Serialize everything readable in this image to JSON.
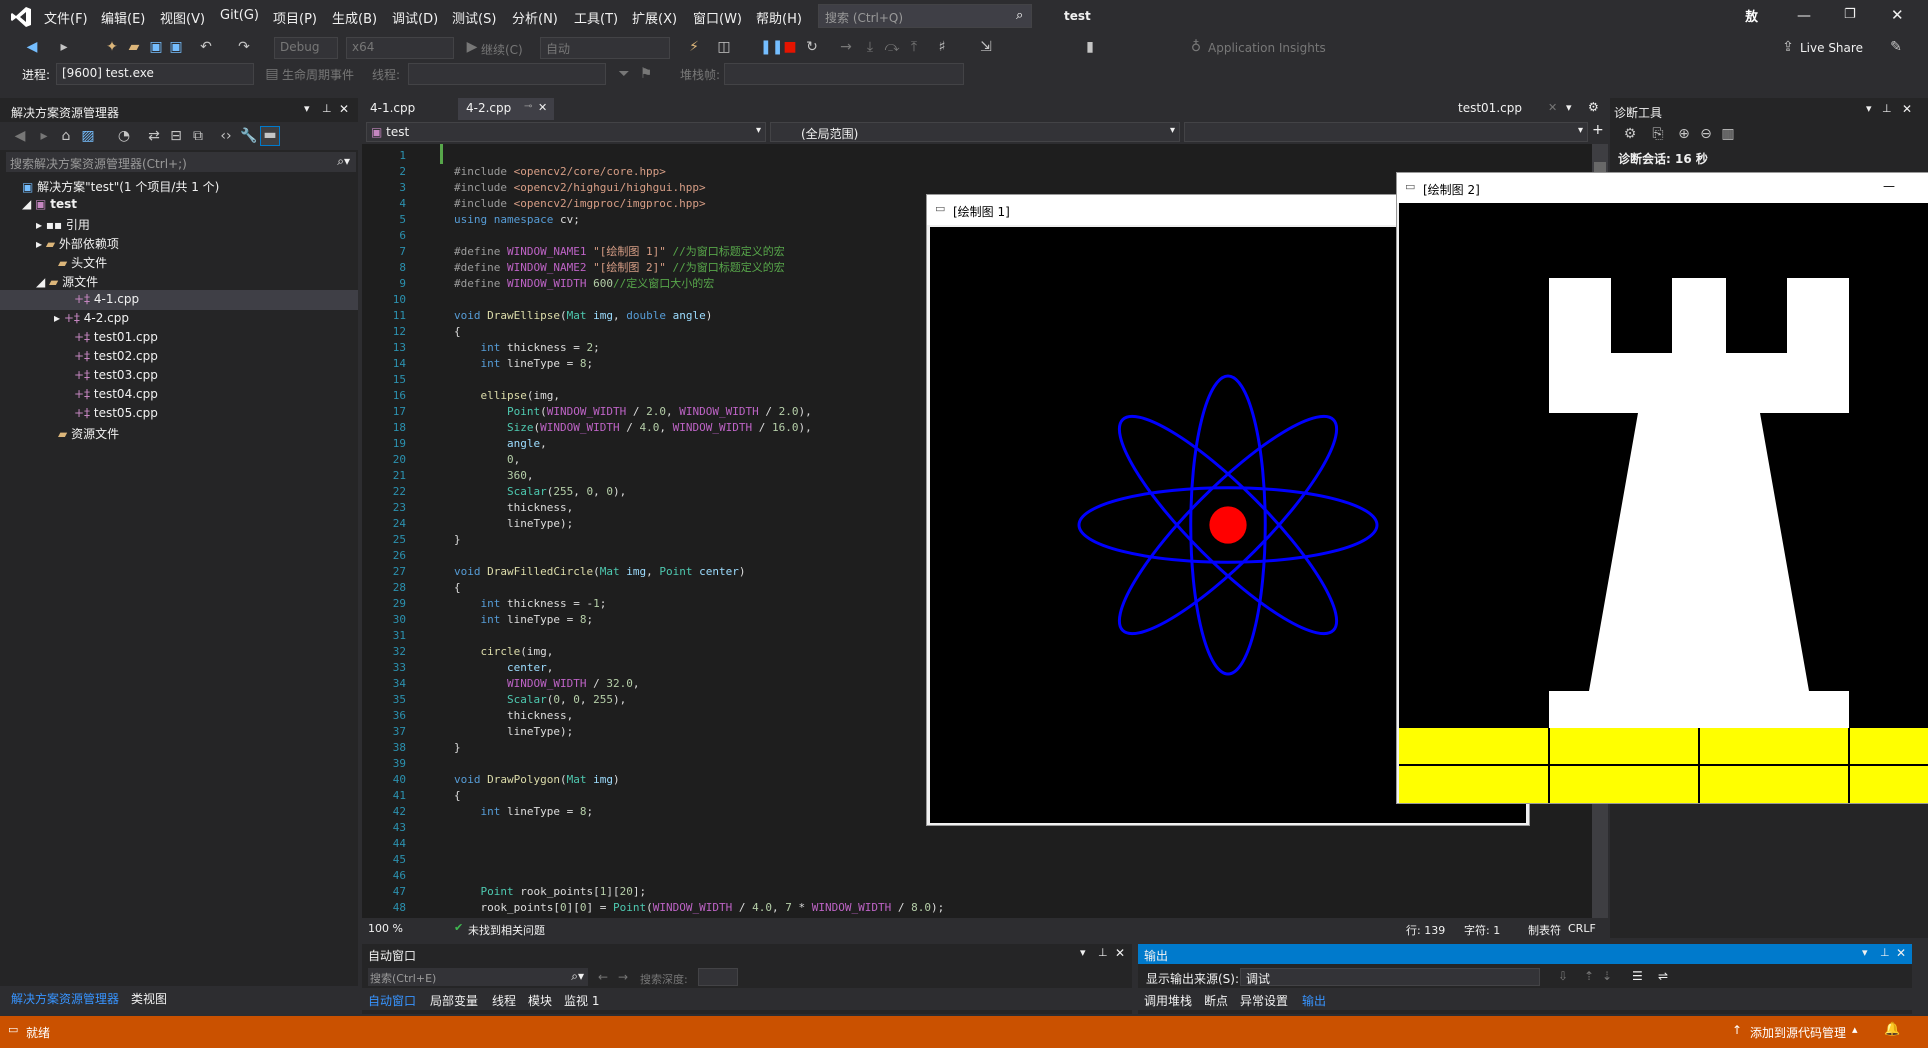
{
  "menubar": {
    "items": [
      "文件(F)",
      "编辑(E)",
      "视图(V)",
      "Git(G)",
      "项目(P)",
      "生成(B)",
      "调试(D)",
      "测试(S)",
      "分析(N)",
      "工具(T)",
      "扩展(X)",
      "窗口(W)",
      "帮助(H)"
    ],
    "search_placeholder": "搜索 (Ctrl+Q)",
    "solution_name": "test",
    "user_badge": "敖"
  },
  "toolbar": {
    "config": "Debug",
    "platform": "x64",
    "continue_label": "继续(C)",
    "auto_label": "自动",
    "app_insights": "Application Insights",
    "live_share": "Live Share"
  },
  "toolbar2": {
    "process_label": "进程:",
    "process_value": "[9600] test.exe",
    "lifecycle_label": "生命周期事件",
    "thread_label": "线程:",
    "stack_label": "堆栈帧:"
  },
  "solution_explorer": {
    "title": "解决方案资源管理器",
    "search_placeholder": "搜索解决方案资源管理器(Ctrl+;)",
    "solution": "解决方案\"test\"(1 个项目/共 1 个)",
    "project": "test",
    "nodes": [
      "引用",
      "外部依赖项",
      "头文件",
      "源文件",
      "4-1.cpp",
      "4-2.cpp",
      "test01.cpp",
      "test02.cpp",
      "test03.cpp",
      "test04.cpp",
      "test05.cpp",
      "资源文件"
    ],
    "bottom_tabs": [
      "解决方案资源管理器",
      "类视图"
    ]
  },
  "editor": {
    "tabs": [
      "4-1.cpp",
      "4-2.cpp"
    ],
    "right_tab": "test01.cpp",
    "nav_project": "test",
    "nav_scope": "(全局范围)",
    "zoom": "100 %",
    "issues": "未找到相关问题",
    "line": "行: 139",
    "char": "字符: 1",
    "tab_mode": "制表符",
    "eol": "CRLF",
    "line_numbers": [
      "1",
      "2",
      "3",
      "4",
      "5",
      "6",
      "7",
      "8",
      "9",
      "10",
      "11",
      "12",
      "13",
      "14",
      "15",
      "16",
      "17",
      "18",
      "19",
      "20",
      "21",
      "22",
      "23",
      "24",
      "25",
      "26",
      "27",
      "28",
      "29",
      "30",
      "31",
      "32",
      "33",
      "34",
      "35",
      "36",
      "37",
      "38",
      "39",
      "40",
      "41",
      "42",
      "43",
      "44",
      "45",
      "46",
      "47",
      "48"
    ]
  },
  "diagnostics": {
    "title": "诊断工具",
    "session": "诊断会话: 16 秒"
  },
  "window1": {
    "title": "[绘制图 1]"
  },
  "window2": {
    "title": "[绘制图 2]"
  },
  "autos": {
    "title": "自动窗口",
    "search_placeholder": "搜索(Ctrl+E)",
    "depth_label": "搜索深度:",
    "tabs": [
      "自动窗口",
      "局部变量",
      "线程",
      "模块",
      "监视 1"
    ]
  },
  "output": {
    "title": "输出",
    "source_label": "显示输出来源(S):",
    "source_value": "调试",
    "tabs": [
      "调用堆栈",
      "断点",
      "异常设置",
      "输出"
    ]
  },
  "status": {
    "ready": "就绪",
    "source_control": "添加到源代码管理"
  },
  "colors": {
    "accent": "#007acc",
    "status": "#ca5100",
    "ellipse": "#0000ff",
    "circle": "#ff0000",
    "rook": "#ffffff",
    "floor": "#ffff00"
  }
}
